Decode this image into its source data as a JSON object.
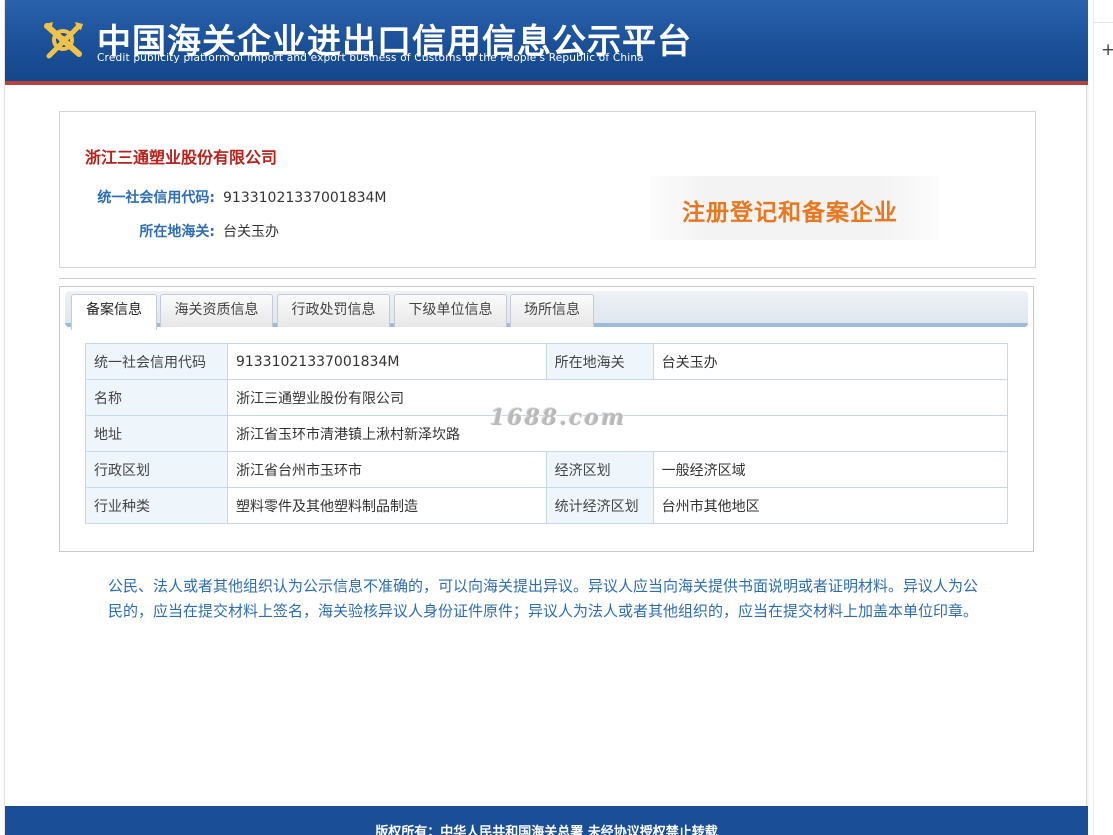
{
  "header": {
    "title": "中国海关企业进出口信用信息公示平台",
    "subtitle": "Credit publicity platform of import and export business of Customs of the People's Republic of China"
  },
  "company": {
    "name": "浙江三通塑业股份有限公司",
    "code_label": "统一社会信用代码:",
    "code_value": "91331021337001834M",
    "customs_label": "所在地海关:",
    "customs_value": "台关玉办",
    "stamp_text": "注册登记和备案企业"
  },
  "tabs": [
    {
      "label": "备案信息",
      "active": true
    },
    {
      "label": "海关资质信息",
      "active": false
    },
    {
      "label": "行政处罚信息",
      "active": false
    },
    {
      "label": "下级单位信息",
      "active": false
    },
    {
      "label": "场所信息",
      "active": false
    }
  ],
  "details": {
    "credit_code_label": "统一社会信用代码",
    "credit_code_value": "91331021337001834M",
    "customs_label": "所在地海关",
    "customs_value": "台关玉办",
    "name_label": "名称",
    "name_value": "浙江三通塑业股份有限公司",
    "address_label": "地址",
    "address_value": "浙江省玉环市清港镇上湫村新泽坎路",
    "admin_region_label": "行政区划",
    "admin_region_value": "浙江省台州市玉环市",
    "econ_zone_label": "经济区划",
    "econ_zone_value": "一般经济区域",
    "industry_label": "行业种类",
    "industry_value": "塑料零件及其他塑料制品制造",
    "stat_zone_label": "统计经济区划",
    "stat_zone_value": "台州市其他地区"
  },
  "watermark": "1688.com",
  "notice": "公民、法人或者其他组织认为公示信息不准确的，可以向海关提出异议。异议人应当向海关提供书面说明或者证明材料。异议人为公民的，应当在提交材料上签名，海关验核异议人身份证件原件；异议人为法人或者其他组织的，应当在提交材料上加盖本单位印章。",
  "footer": {
    "copyright": "版权所有：中华人民共和国海关总署  未经协议授权禁止转载"
  },
  "sidebar": {
    "plus_icon": "+"
  },
  "colors": {
    "header_blue": "#1a4f97",
    "header_border_red": "#b9413b",
    "company_name_red": "#b8211c",
    "label_blue": "#2e6db2",
    "stamp_orange": "#e8771f"
  }
}
